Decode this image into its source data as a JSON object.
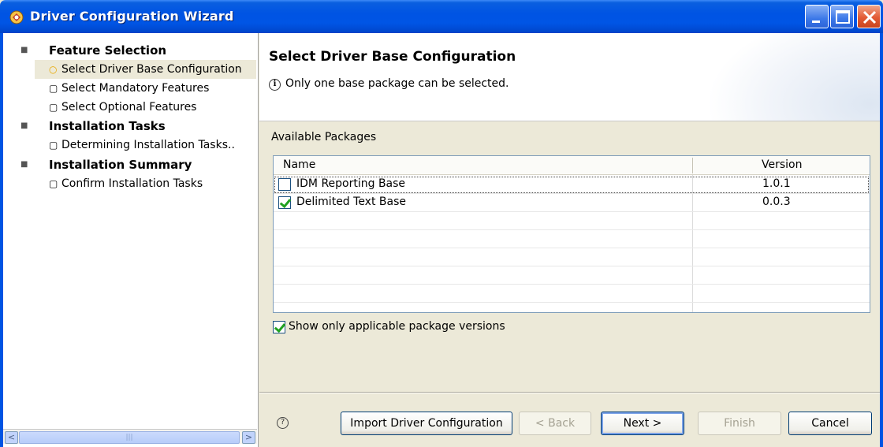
{
  "window": {
    "title": "Driver Configuration Wizard",
    "accent_color": "#0054e3",
    "controls": [
      "minimize-icon",
      "maximize-icon",
      "close-icon"
    ]
  },
  "nav": {
    "sections": [
      {
        "label": "Feature Selection",
        "children": [
          {
            "label": "Select Driver Base Configuration",
            "icon": "current-step-icon",
            "active": true
          },
          {
            "label": "Select Mandatory Features",
            "icon": "page-icon",
            "active": false
          },
          {
            "label": "Select Optional Features",
            "icon": "page-icon",
            "active": false
          }
        ]
      },
      {
        "label": "Installation Tasks",
        "children": [
          {
            "label": "Determining Installation Tasks..",
            "icon": "page-icon",
            "active": false
          }
        ]
      },
      {
        "label": "Installation Summary",
        "children": [
          {
            "label": "Confirm Installation Tasks",
            "icon": "page-icon",
            "active": false
          }
        ]
      }
    ]
  },
  "page": {
    "title": "Select Driver Base Configuration",
    "info_message": "Only one base package can be selected."
  },
  "packages": {
    "label": "Available Packages",
    "columns": [
      "Name",
      "Version"
    ],
    "rows": [
      {
        "name": "IDM Reporting Base",
        "version": "1.0.1",
        "checked": false
      },
      {
        "name": "Delimited Text Base",
        "version": "0.0.3",
        "checked": true
      }
    ],
    "show_only_label": "Show only applicable package versions",
    "show_only_checked": true
  },
  "buttons": {
    "import": "Import Driver Configuration",
    "back": "< Back",
    "next": "Next >",
    "finish": "Finish",
    "cancel": "Cancel"
  }
}
